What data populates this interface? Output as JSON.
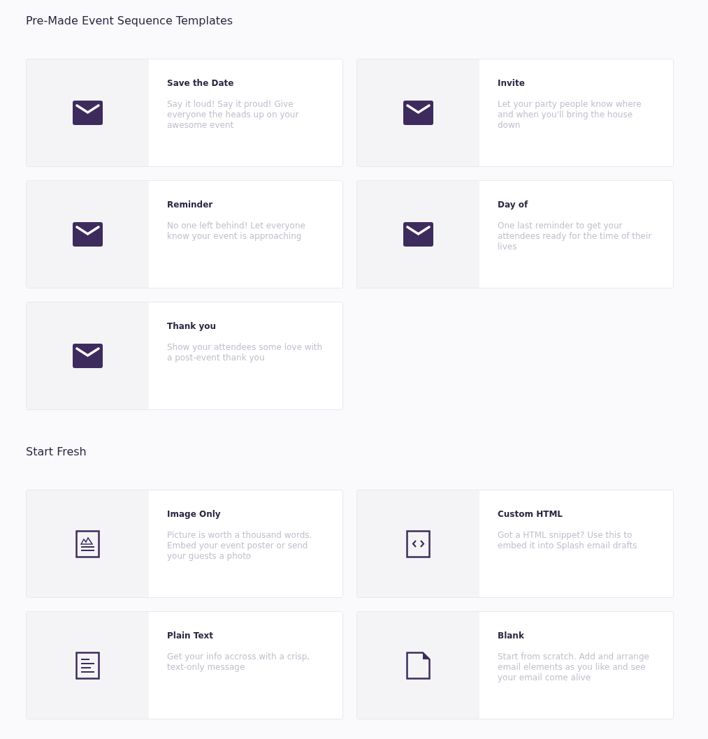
{
  "sections": [
    {
      "title": "Pre-Made Event Sequence Templates",
      "cards": [
        {
          "kind": "envelope",
          "title": "Save the Date",
          "description": "Say it loud! Say it proud! Give everyone the heads up on your awesome event"
        },
        {
          "kind": "envelope",
          "title": "Invite",
          "description": "Let your party people know where and when you'll bring the house down"
        },
        {
          "kind": "envelope",
          "title": "Reminder",
          "description": "No one left behind! Let everyone know your event is approaching"
        },
        {
          "kind": "envelope",
          "title": "Day of",
          "description": "One last reminder to get your attendees ready for the time of their lives"
        },
        {
          "kind": "envelope",
          "title": "Thank you",
          "description": "Show your attendees some love with a post-event thank you"
        }
      ]
    },
    {
      "title": "Start Fresh",
      "cards": [
        {
          "kind": "image",
          "title": "Image Only",
          "description": "Picture is worth a thousand words. Embed your event poster or send your guests a photo"
        },
        {
          "kind": "code",
          "title": "Custom HTML",
          "description": "Got a HTML snippet? Use this to embed it into Splash email drafts"
        },
        {
          "kind": "text",
          "title": "Plain Text",
          "description": "Get your info accross with a crisp, text-only message"
        },
        {
          "kind": "blank",
          "title": "Blank",
          "description": "Start from scratch. Add and arrange email elements as you like and see your email come alive"
        }
      ]
    }
  ]
}
